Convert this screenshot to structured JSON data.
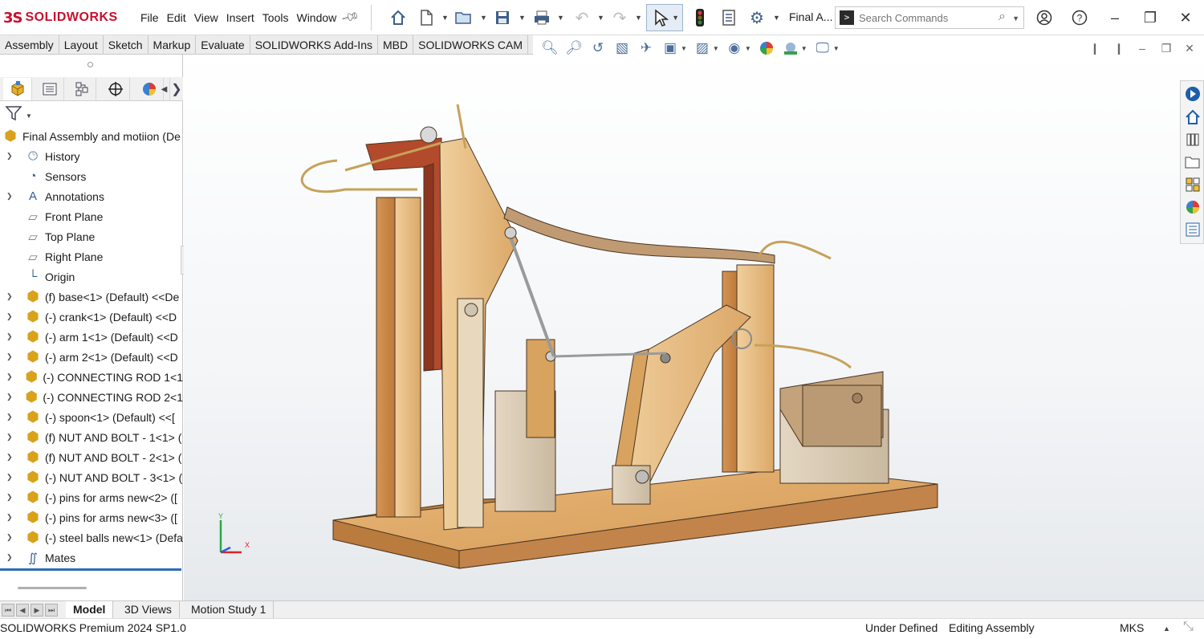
{
  "app": {
    "logo_mark": "3S",
    "logo_text": "SOLIDWORKS",
    "menu": [
      "File",
      "Edit",
      "View",
      "Insert",
      "Tools",
      "Window"
    ],
    "doc_title": "Final A...",
    "search_placeholder": "Search Commands",
    "search_prompt": ">"
  },
  "command_tabs": [
    "Assembly",
    "Layout",
    "Sketch",
    "Markup",
    "Evaluate",
    "SOLIDWORKS Add-Ins",
    "MBD",
    "SOLIDWORKS CAM"
  ],
  "tree": {
    "root": "Final Assembly and motiion (De",
    "items": [
      {
        "label": "History",
        "icon": "history-icon",
        "expand": true
      },
      {
        "label": "Sensors",
        "icon": "sensors-icon",
        "expand": false
      },
      {
        "label": "Annotations",
        "icon": "annotations-icon",
        "expand": true
      },
      {
        "label": "Front Plane",
        "icon": "plane-icon",
        "expand": false
      },
      {
        "label": "Top Plane",
        "icon": "plane-icon",
        "expand": false
      },
      {
        "label": "Right Plane",
        "icon": "plane-icon",
        "expand": false
      },
      {
        "label": "Origin",
        "icon": "origin-icon",
        "expand": false
      },
      {
        "label": "(f) base<1> (Default) <<De",
        "icon": "part-icon",
        "expand": true
      },
      {
        "label": "(-) crank<1> (Default) <<D",
        "icon": "part-icon",
        "expand": true
      },
      {
        "label": "(-) arm 1<1> (Default) <<D",
        "icon": "part-icon",
        "expand": true
      },
      {
        "label": "(-) arm 2<1> (Default) <<D",
        "icon": "part-icon",
        "expand": true
      },
      {
        "label": "(-) CONNECTING ROD 1<1",
        "icon": "part-icon",
        "expand": true
      },
      {
        "label": "(-) CONNECTING ROD 2<1",
        "icon": "part-icon",
        "expand": true
      },
      {
        "label": "(-) spoon<1> (Default) <<[",
        "icon": "part-icon",
        "expand": true
      },
      {
        "label": "(f) NUT AND BOLT - 1<1> (",
        "icon": "part-icon",
        "expand": true
      },
      {
        "label": "(f) NUT AND BOLT - 2<1> (",
        "icon": "part-icon",
        "expand": true
      },
      {
        "label": "(-) NUT AND BOLT - 3<1> (",
        "icon": "part-icon",
        "expand": true
      },
      {
        "label": "(-) pins for arms new<2> ([",
        "icon": "part-icon",
        "expand": true
      },
      {
        "label": "(-) pins for arms new<3> ([",
        "icon": "part-icon",
        "expand": true
      },
      {
        "label": "(-) steel balls new<1> (Defa",
        "icon": "part-icon",
        "expand": true
      },
      {
        "label": "Mates",
        "icon": "mates-icon",
        "expand": true
      }
    ]
  },
  "bottom_tabs": [
    "Model",
    "3D Views",
    "Motion Study 1"
  ],
  "status": {
    "product": "SOLIDWORKS Premium 2024 SP1.0",
    "definition": "Under Defined",
    "mode": "Editing Assembly",
    "units": "MKS"
  },
  "triad": {
    "y": "Y",
    "x": "X"
  },
  "colors": {
    "brand_red": "#c8102e",
    "wood_light": "#e8c08a",
    "wood_dark": "#c98a4a",
    "rust": "#b34a2c",
    "selection_blue": "#2e6db5"
  }
}
